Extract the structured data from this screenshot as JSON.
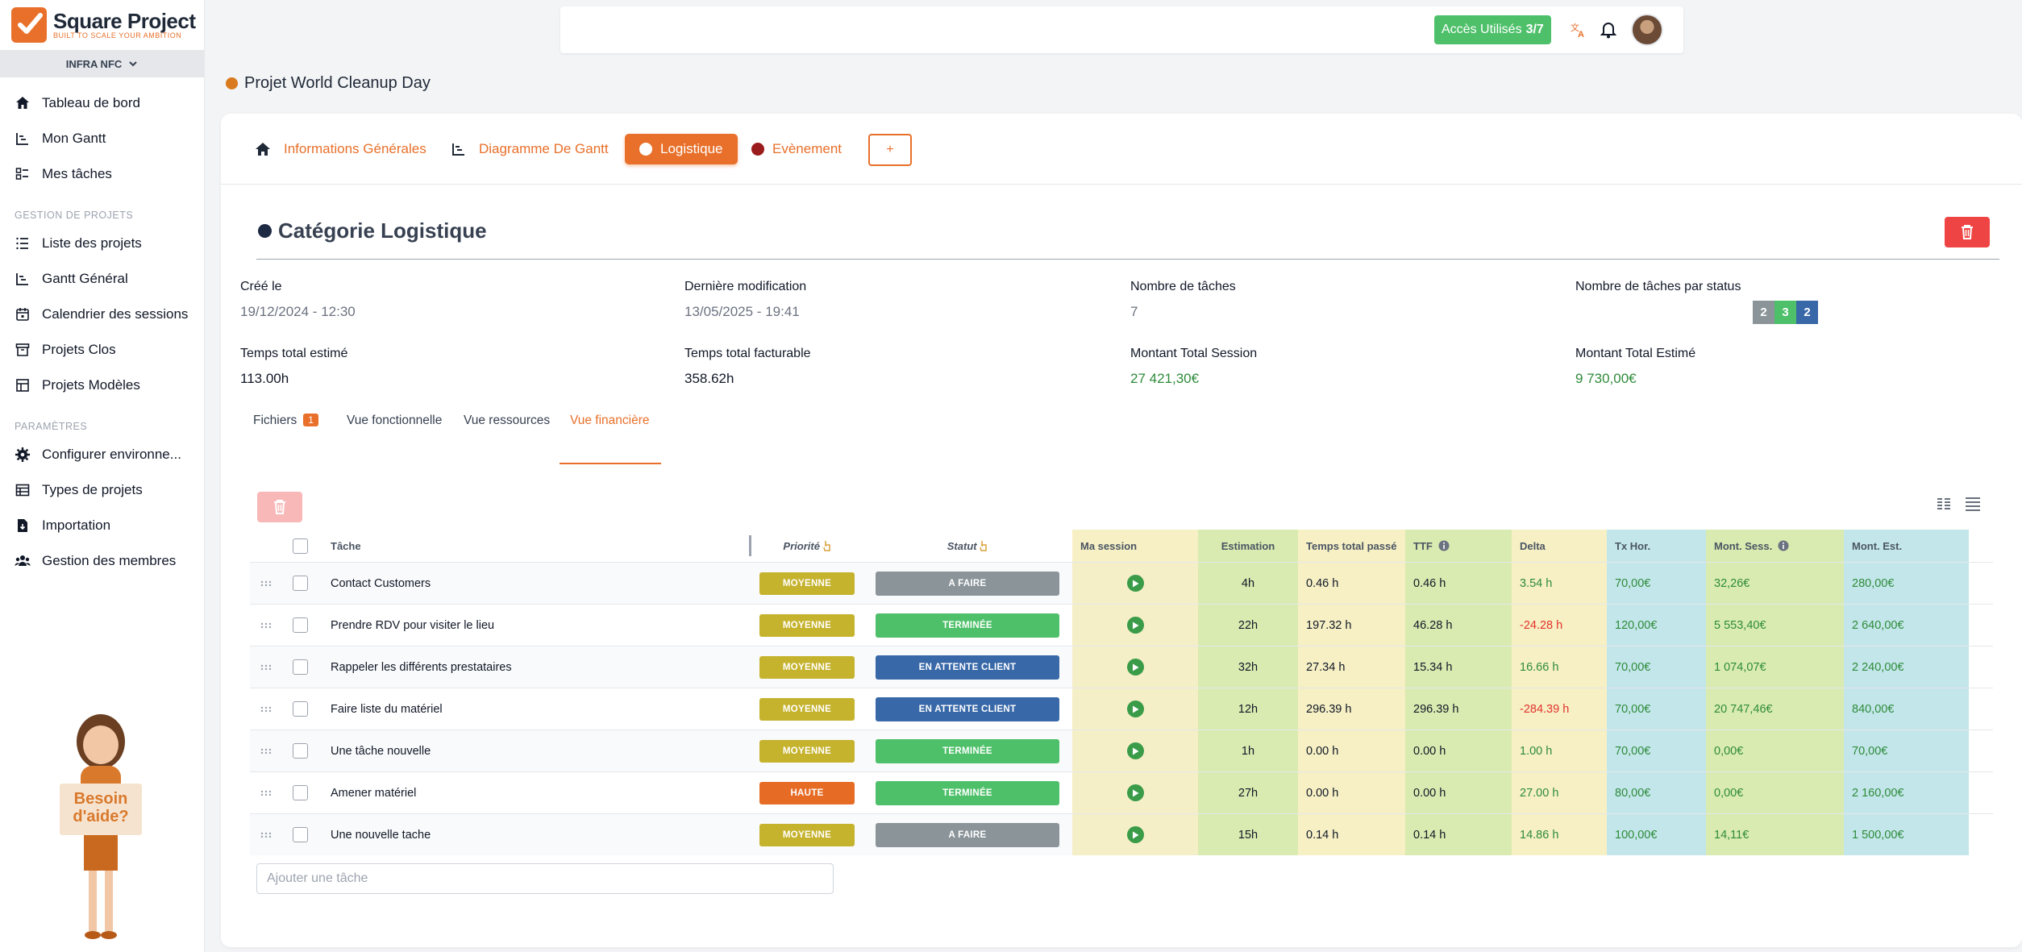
{
  "brand": {
    "name": "Square Project",
    "tagline": "BUILT TO SCALE YOUR AMBITION",
    "accent": "#e8702a"
  },
  "workspace": {
    "name": "INFRA NFC"
  },
  "sidebar": {
    "main": [
      {
        "label": "Tableau de bord",
        "icon": "home-icon"
      },
      {
        "label": "Mon Gantt",
        "icon": "gantt-icon"
      },
      {
        "label": "Mes tâches",
        "icon": "tasks-icon"
      }
    ],
    "section_projects": "GESTION DE PROJETS",
    "projects": [
      {
        "label": "Liste des projets",
        "icon": "list-icon"
      },
      {
        "label": "Gantt Général",
        "icon": "gantt-icon"
      },
      {
        "label": "Calendrier des sessions",
        "icon": "calendar-icon"
      },
      {
        "label": "Projets Clos",
        "icon": "archive-icon"
      },
      {
        "label": "Projets Modèles",
        "icon": "template-icon"
      }
    ],
    "section_params": "PARAMÈTRES",
    "params": [
      {
        "label": "Configurer environne...",
        "icon": "gear-icon"
      },
      {
        "label": "Types de projets",
        "icon": "table-icon"
      },
      {
        "label": "Importation",
        "icon": "import-icon"
      },
      {
        "label": "Gestion des membres",
        "icon": "users-icon"
      }
    ],
    "help": {
      "line1": "Besoin",
      "line2": "d'aide?"
    }
  },
  "topbar": {
    "access_label": "Accès Utilisés",
    "access_count": "3/7"
  },
  "project": {
    "title": "Projet World Cleanup Day",
    "color": "#d97a1e"
  },
  "project_tabs": [
    {
      "label": "Informations Générales",
      "icon": "home-icon"
    },
    {
      "label": "Diagramme De Gantt",
      "icon": "gantt-icon"
    },
    {
      "label": "Logistique",
      "active": true
    },
    {
      "label": "Evènement",
      "dot_color": "#9b1c1c"
    },
    {
      "label": "+"
    }
  ],
  "category": {
    "title": "Catégorie Logistique",
    "info": {
      "created_label": "Créé le",
      "created_value": "19/12/2024 - 12:30",
      "modified_label": "Dernière modification",
      "modified_value": "13/05/2025 - 19:41",
      "tasks_label": "Nombre de tâches",
      "tasks_value": "7",
      "status_label": "Nombre de tâches par status",
      "status_counts": [
        {
          "value": "2",
          "color": "#8a9499"
        },
        {
          "value": "3",
          "color": "#4ec06a"
        },
        {
          "value": "2",
          "color": "#3868a8"
        }
      ],
      "est_time_label": "Temps total estimé",
      "est_time_value": "113.00h",
      "bill_time_label": "Temps total facturable",
      "bill_time_value": "358.62h",
      "session_amount_label": "Montant Total Session",
      "session_amount_value": "27 421,30€",
      "est_amount_label": "Montant Total Estimé",
      "est_amount_value": "9 730,00€"
    }
  },
  "subtabs": [
    {
      "label": "Fichiers",
      "badge": "1"
    },
    {
      "label": "Vue fonctionnelle"
    },
    {
      "label": "Vue ressources"
    },
    {
      "label": "Vue financière",
      "active": true
    }
  ],
  "table": {
    "headers": {
      "task": "Tâche",
      "priority": "Priorité",
      "status": "Statut",
      "session": "Ma session",
      "estimation": "Estimation",
      "time_spent": "Temps total passé",
      "ttf": "TTF",
      "delta": "Delta",
      "rate": "Tx Hor.",
      "session_amount": "Mont. Sess.",
      "est_amount": "Mont. Est."
    },
    "rows": [
      {
        "task": "Contact Customers",
        "priority": "MOYENNE",
        "status": "A FAIRE",
        "estimation": "4h",
        "time_spent": "0.46 h",
        "ttf": "0.46 h",
        "delta": "3.54 h",
        "rate": "70,00€",
        "session_amount": "32,26€",
        "est_amount": "280,00€"
      },
      {
        "task": "Prendre RDV pour visiter le lieu",
        "priority": "MOYENNE",
        "status": "TERMINÉE",
        "estimation": "22h",
        "time_spent": "197.32 h",
        "ttf": "46.28 h",
        "delta": "-24.28 h",
        "rate": "120,00€",
        "session_amount": "5 553,40€",
        "est_amount": "2 640,00€"
      },
      {
        "task": "Rappeler les différents prestataires",
        "priority": "MOYENNE",
        "status": "EN ATTENTE CLIENT",
        "estimation": "32h",
        "time_spent": "27.34 h",
        "ttf": "15.34 h",
        "delta": "16.66 h",
        "rate": "70,00€",
        "session_amount": "1 074,07€",
        "est_amount": "2 240,00€"
      },
      {
        "task": "Faire liste du matériel",
        "priority": "MOYENNE",
        "status": "EN ATTENTE CLIENT",
        "estimation": "12h",
        "time_spent": "296.39 h",
        "ttf": "296.39 h",
        "delta": "-284.39 h",
        "rate": "70,00€",
        "session_amount": "20 747,46€",
        "est_amount": "840,00€"
      },
      {
        "task": "Une tâche nouvelle",
        "priority": "MOYENNE",
        "status": "TERMINÉE",
        "estimation": "1h",
        "time_spent": "0.00 h",
        "ttf": "0.00 h",
        "delta": "1.00 h",
        "rate": "70,00€",
        "session_amount": "0,00€",
        "est_amount": "70,00€"
      },
      {
        "task": "Amener matériel",
        "priority": "HAUTE",
        "status": "TERMINÉE",
        "estimation": "27h",
        "time_spent": "0.00 h",
        "ttf": "0.00 h",
        "delta": "27.00 h",
        "rate": "80,00€",
        "session_amount": "0,00€",
        "est_amount": "2 160,00€"
      },
      {
        "task": "Une nouvelle tache",
        "priority": "MOYENNE",
        "status": "A FAIRE",
        "estimation": "15h",
        "time_spent": "0.14 h",
        "ttf": "0.14 h",
        "delta": "14.86 h",
        "rate": "100,00€",
        "session_amount": "14,11€",
        "est_amount": "1 500,00€"
      }
    ],
    "add_placeholder": "Ajouter une tâche"
  },
  "colors": {
    "priority": {
      "MOYENNE": "#c5b22d",
      "HAUTE": "#e66b25"
    },
    "status": {
      "A FAIRE": "#8a9499",
      "TERMINÉE": "#4ec06a",
      "EN ATTENTE CLIENT": "#3868a8"
    }
  }
}
